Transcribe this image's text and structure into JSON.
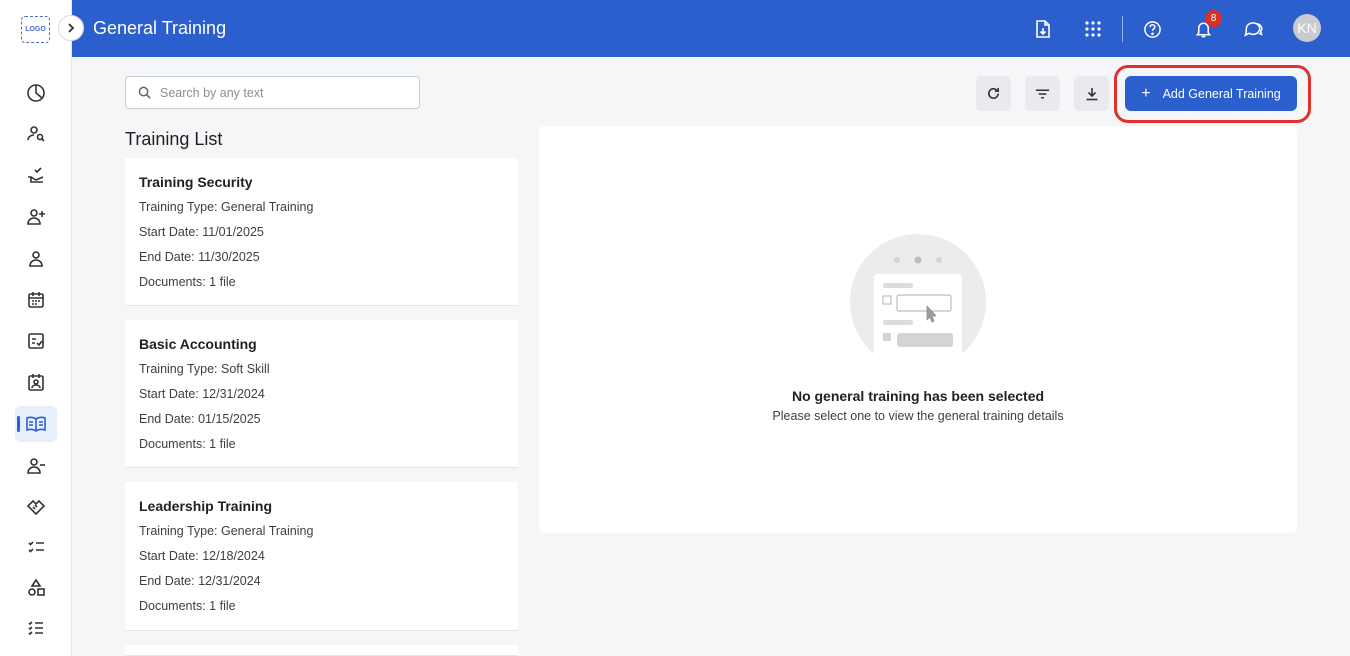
{
  "app": {
    "logo_text": "LOGO",
    "page_title": "General Training",
    "notifications_count": "8",
    "user_initials": "KN"
  },
  "sidebar": {
    "items": [
      {
        "name": "dashboard-icon"
      },
      {
        "name": "recruitment-icon"
      },
      {
        "name": "onboarding-icon"
      },
      {
        "name": "add-employee-icon"
      },
      {
        "name": "employee-icon"
      },
      {
        "name": "calendar-icon"
      },
      {
        "name": "evaluation-icon"
      },
      {
        "name": "contact-card-icon"
      },
      {
        "name": "training-book-icon",
        "active": true
      },
      {
        "name": "offboarding-icon"
      },
      {
        "name": "handshake-icon"
      },
      {
        "name": "checklist-icon"
      },
      {
        "name": "shapes-icon"
      },
      {
        "name": "list-icon"
      }
    ]
  },
  "toolbar": {
    "search_placeholder": "Search by any text",
    "add_label": "Add General Training"
  },
  "list": {
    "title": "Training List",
    "items": [
      {
        "title": "Training Security",
        "type": "Training Type: General Training",
        "start": "Start Date: 11/01/2025",
        "end": "End Date: 11/30/2025",
        "docs": "Documents: 1 file"
      },
      {
        "title": "Basic Accounting",
        "type": "Training Type: Soft Skill",
        "start": "Start Date: 12/31/2024",
        "end": "End Date: 01/15/2025",
        "docs": "Documents: 1 file"
      },
      {
        "title": "Leadership Training",
        "type": "Training Type: General Training",
        "start": "Start Date: 12/18/2024",
        "end": "End Date: 12/31/2024",
        "docs": "Documents: 1 file"
      }
    ]
  },
  "detail": {
    "empty_title": "No general training has been selected",
    "empty_subtitle": "Please select one to view the general training details"
  },
  "colors": {
    "brand": "#2b5fce",
    "highlight": "#e2312b",
    "badge": "#d93025"
  }
}
